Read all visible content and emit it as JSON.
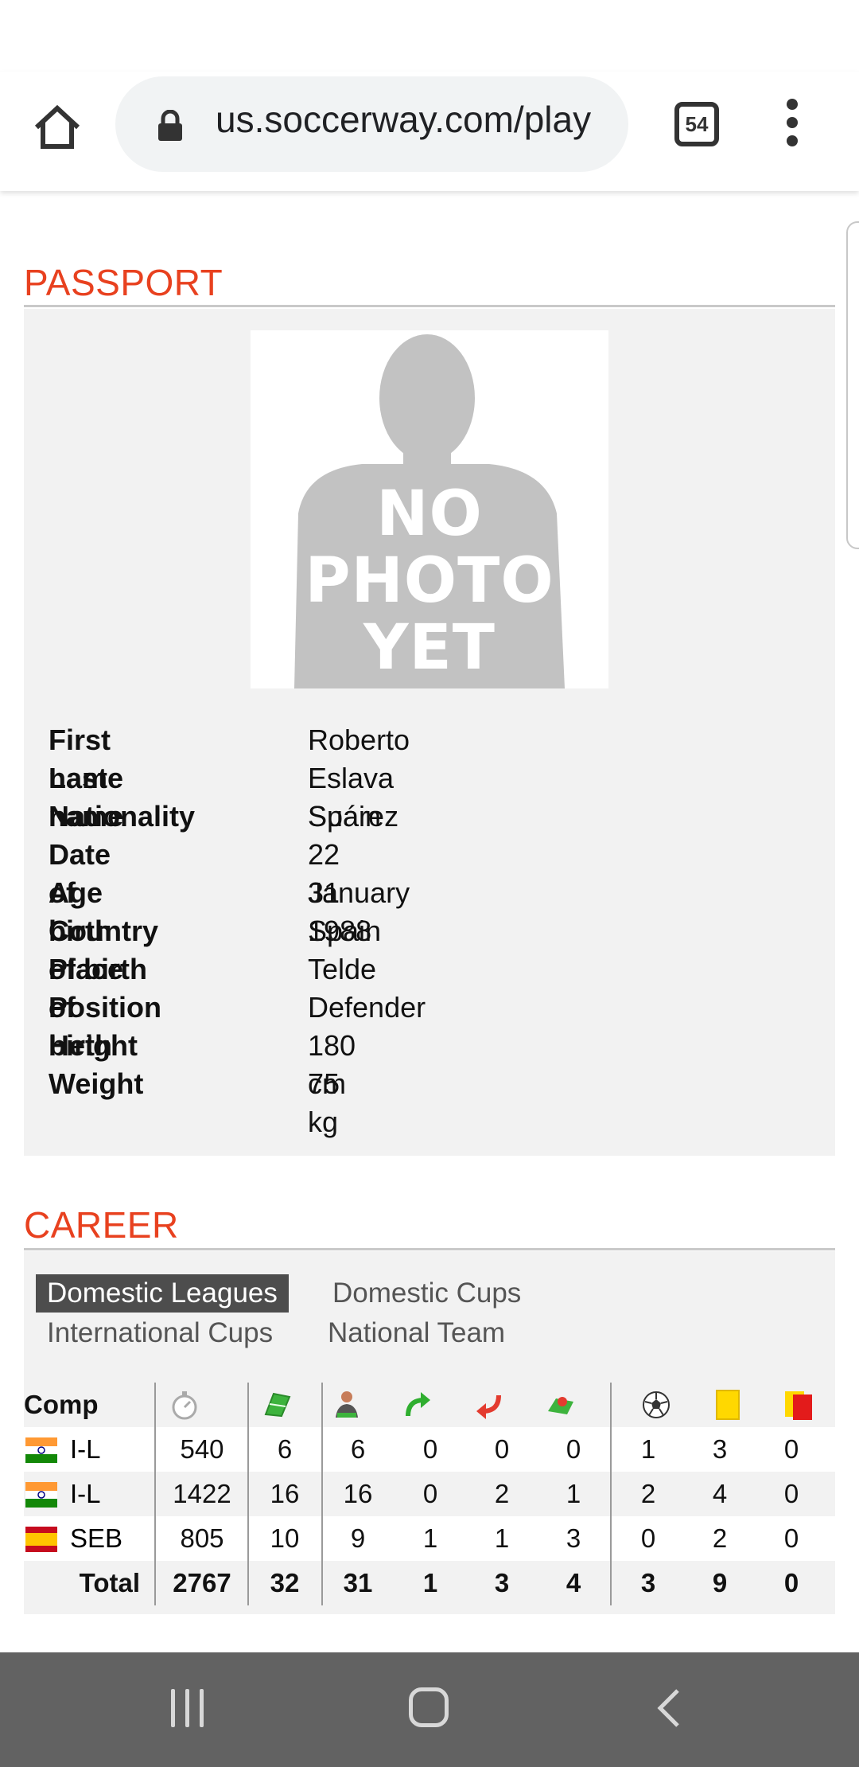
{
  "browser": {
    "url": "us.soccerway.com/play",
    "tab_count": "54"
  },
  "passport": {
    "title": "PASSPORT",
    "photo_text": [
      "NO",
      "PHOTO",
      "YET"
    ],
    "fields": [
      {
        "label": "First name",
        "value": "Roberto"
      },
      {
        "label": "Last name",
        "value": "Eslava Suárez"
      },
      {
        "label": "Nationality",
        "value": "Spain"
      },
      {
        "label": "Date of birth",
        "value": "22 January 1988"
      },
      {
        "label": "Age",
        "value": "31"
      },
      {
        "label": "Country of birth",
        "value": "Spain"
      },
      {
        "label": "Place of birth",
        "value": "Telde"
      },
      {
        "label": "Position",
        "value": "Defender"
      },
      {
        "label": "Height",
        "value": "180 cm"
      },
      {
        "label": "Weight",
        "value": "75 kg"
      }
    ]
  },
  "career": {
    "title": "CAREER",
    "tabs": [
      {
        "label": "Domestic Leagues",
        "active": true
      },
      {
        "label": "Domestic Cups",
        "active": false
      },
      {
        "label": "International Cups",
        "active": false
      },
      {
        "label": "National Team",
        "active": false
      }
    ],
    "table": {
      "comp_header": "Comp",
      "column_icons": [
        "stopwatch-icon",
        "pitch-icon",
        "player-lineup-icon",
        "substitute-in-icon",
        "substitute-out-icon",
        "bench-icon",
        "ball-icon",
        "yellow-card-icon",
        "red-card-icon"
      ],
      "rows": [
        {
          "flag": "india-flag",
          "comp": "I-L",
          "values": [
            "540",
            "6",
            "6",
            "0",
            "0",
            "0",
            "1",
            "3",
            "0"
          ]
        },
        {
          "flag": "india-flag",
          "comp": "I-L",
          "values": [
            "1422",
            "16",
            "16",
            "0",
            "2",
            "1",
            "2",
            "4",
            "0"
          ]
        },
        {
          "flag": "spain-flag",
          "comp": "SEB",
          "values": [
            "805",
            "10",
            "9",
            "1",
            "1",
            "3",
            "0",
            "2",
            "0"
          ]
        }
      ],
      "total": {
        "label": "Total",
        "values": [
          "2767",
          "32",
          "31",
          "1",
          "3",
          "4",
          "3",
          "9",
          "0"
        ]
      }
    }
  },
  "colors": {
    "section_title": "#e8411f",
    "box_bg": "#f2f2f2",
    "active_tab": "#4d4d4d",
    "navbar": "#626262"
  }
}
